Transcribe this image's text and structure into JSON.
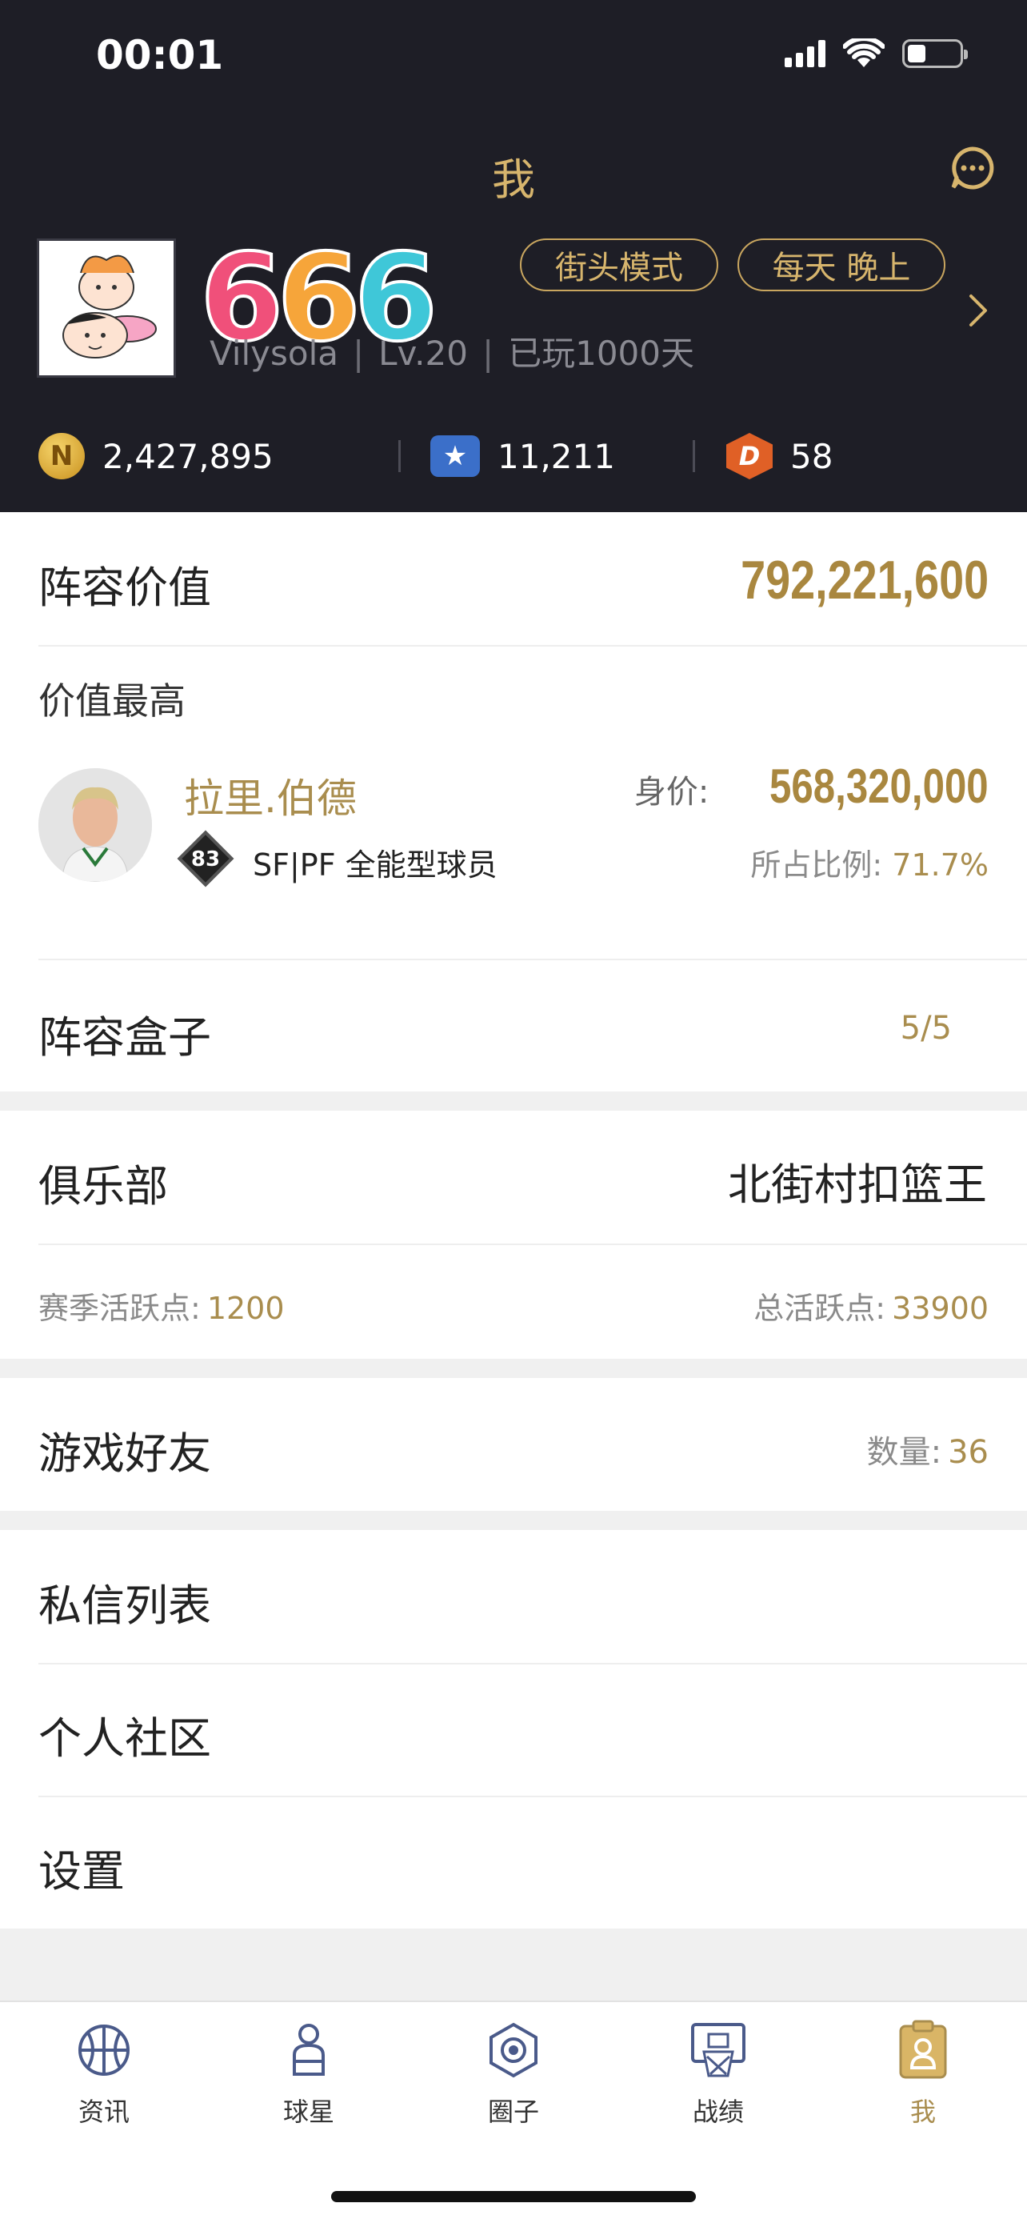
{
  "status_bar": {
    "time": "00:01"
  },
  "header": {
    "title": "我",
    "tags": [
      "街头模式",
      "每天 晚上"
    ],
    "username": "Vilysola",
    "level": "Lv.20",
    "played_days": "已玩1000天",
    "logo_text": "666",
    "currencies": [
      {
        "icon": "gold-coin-icon",
        "value": "2,427,895"
      },
      {
        "icon": "blue-star-icon",
        "value": "11,211"
      },
      {
        "icon": "d-badge-icon",
        "value": "58"
      }
    ]
  },
  "lineup": {
    "label": "阵容价值",
    "total_value": "792,221,600",
    "top_label": "价值最高",
    "player": {
      "name": "拉里.伯德",
      "rating": "83",
      "position": "SF|PF 全能型球员",
      "price_label": "身价:",
      "price": "568,320,000",
      "ratio_label": "所占比例:",
      "ratio": "71.7%"
    },
    "box_label": "阵容盒子",
    "box_count": "5/5"
  },
  "club": {
    "label": "俱乐部",
    "name": "北街村扣篮王",
    "season_label": "赛季活跃点:",
    "season_value": "1200",
    "total_label": "总活跃点:",
    "total_value": "33900"
  },
  "friends": {
    "label": "游戏好友",
    "count_label": "数量:",
    "count": "36"
  },
  "menu": {
    "messages": "私信列表",
    "community": "个人社区",
    "settings": "设置"
  },
  "tabbar": {
    "items": [
      {
        "label": "资讯",
        "icon": "basketball-icon"
      },
      {
        "label": "球星",
        "icon": "player-icon"
      },
      {
        "label": "圈子",
        "icon": "circle-icon"
      },
      {
        "label": "战绩",
        "icon": "hoop-icon"
      },
      {
        "label": "我",
        "icon": "profile-card-icon"
      }
    ],
    "active": "我"
  },
  "colors": {
    "header_bg": "#1e1e26",
    "accent_gold": "#a98d4e",
    "title_gold": "#d7b56d"
  }
}
